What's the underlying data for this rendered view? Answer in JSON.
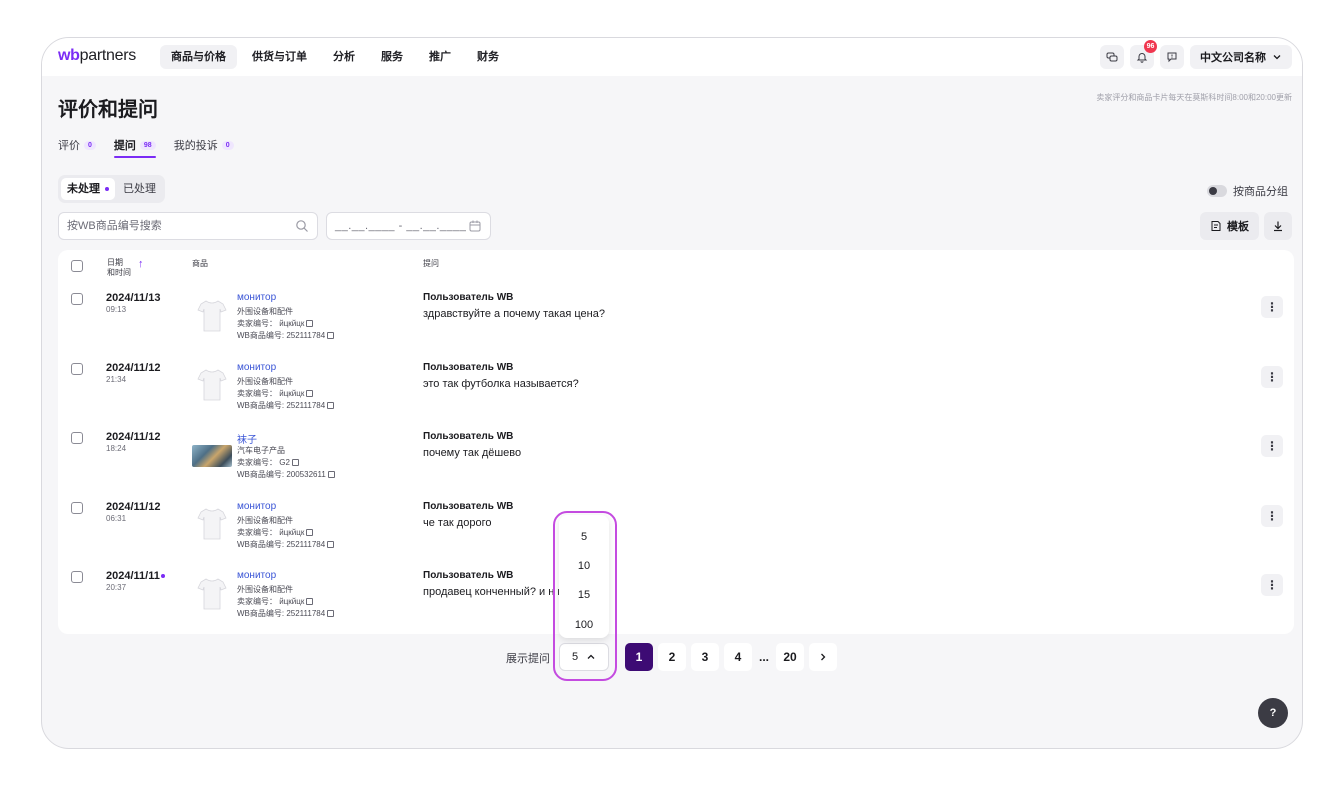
{
  "header": {
    "logo_wb": "wb",
    "logo_rest": "partners",
    "nav": [
      "商品与价格",
      "供货与订单",
      "分析",
      "服务",
      "推广",
      "财务"
    ],
    "notification_count": "96",
    "company": "中文公司名称"
  },
  "update_note": "卖家评分和商品卡片每天在莫斯科时间8:00和20:00更新",
  "page_title": "评价和提问",
  "tabs": [
    {
      "label": "评价",
      "count": "0"
    },
    {
      "label": "提问",
      "count": "98"
    },
    {
      "label": "我的投诉",
      "count": "0"
    }
  ],
  "segment": {
    "unprocessed": "未处理",
    "processed": "已处理"
  },
  "group_toggle": "按商品分组",
  "search": {
    "placeholder": "按WB商品编号搜索",
    "value": ""
  },
  "date_range": "__.__.____ - __.__.____",
  "toolbar": {
    "template": "模板"
  },
  "table": {
    "headers": {
      "date_line1": "日期",
      "date_line2": "和时间",
      "product": "商品",
      "question": "提问"
    },
    "rows": [
      {
        "date": "2024/11/13",
        "time": "09:13",
        "product_name": "монитор",
        "category": "外围设备和配件",
        "vendor": "卖家编号： йцкйцк",
        "wb": "WB商品编号: 252111784",
        "user": "Пользователь WB",
        "text": "здравствуйте а почему такая цена?",
        "unread": false,
        "thumb": "tshirt"
      },
      {
        "date": "2024/11/12",
        "time": "21:34",
        "product_name": "монитор",
        "category": "外围设备和配件",
        "vendor": "卖家编号： йцкйцк",
        "wb": "WB商品编号: 252111784",
        "user": "Пользователь WB",
        "text": "это так футболка называется?",
        "unread": false,
        "thumb": "tshirt"
      },
      {
        "date": "2024/11/12",
        "time": "18:24",
        "product_name": "袜子",
        "category": "汽车电子产品",
        "vendor": "卖家编号： G2",
        "wb": "WB商品编号: 200532611",
        "user": "Пользователь WB",
        "text": "почему так дёшево",
        "unread": false,
        "thumb": "photo"
      },
      {
        "date": "2024/11/12",
        "time": "06:31",
        "product_name": "монитор",
        "category": "外围设备和配件",
        "vendor": "卖家编号： йцкйцк",
        "wb": "WB商品编号: 252111784",
        "user": "Пользователь WB",
        "text": "че так дорого",
        "unread": false,
        "thumb": "tshirt"
      },
      {
        "date": "2024/11/11",
        "time": "20:37",
        "product_name": "монитор",
        "category": "外围设备和配件",
        "vendor": "卖家编号： йцкйцк",
        "wb": "WB商品编号: 252111784",
        "user": "Пользователь WB",
        "text": "продавец конченный? и         н принял",
        "unread": true,
        "thumb": "tshirt"
      }
    ]
  },
  "pagination": {
    "label": "展示提问",
    "selected": "5",
    "options": [
      "5",
      "10",
      "15",
      "100"
    ],
    "pages": [
      "1",
      "2",
      "3",
      "4",
      "...",
      "20"
    ],
    "current": "1"
  },
  "help": "?"
}
